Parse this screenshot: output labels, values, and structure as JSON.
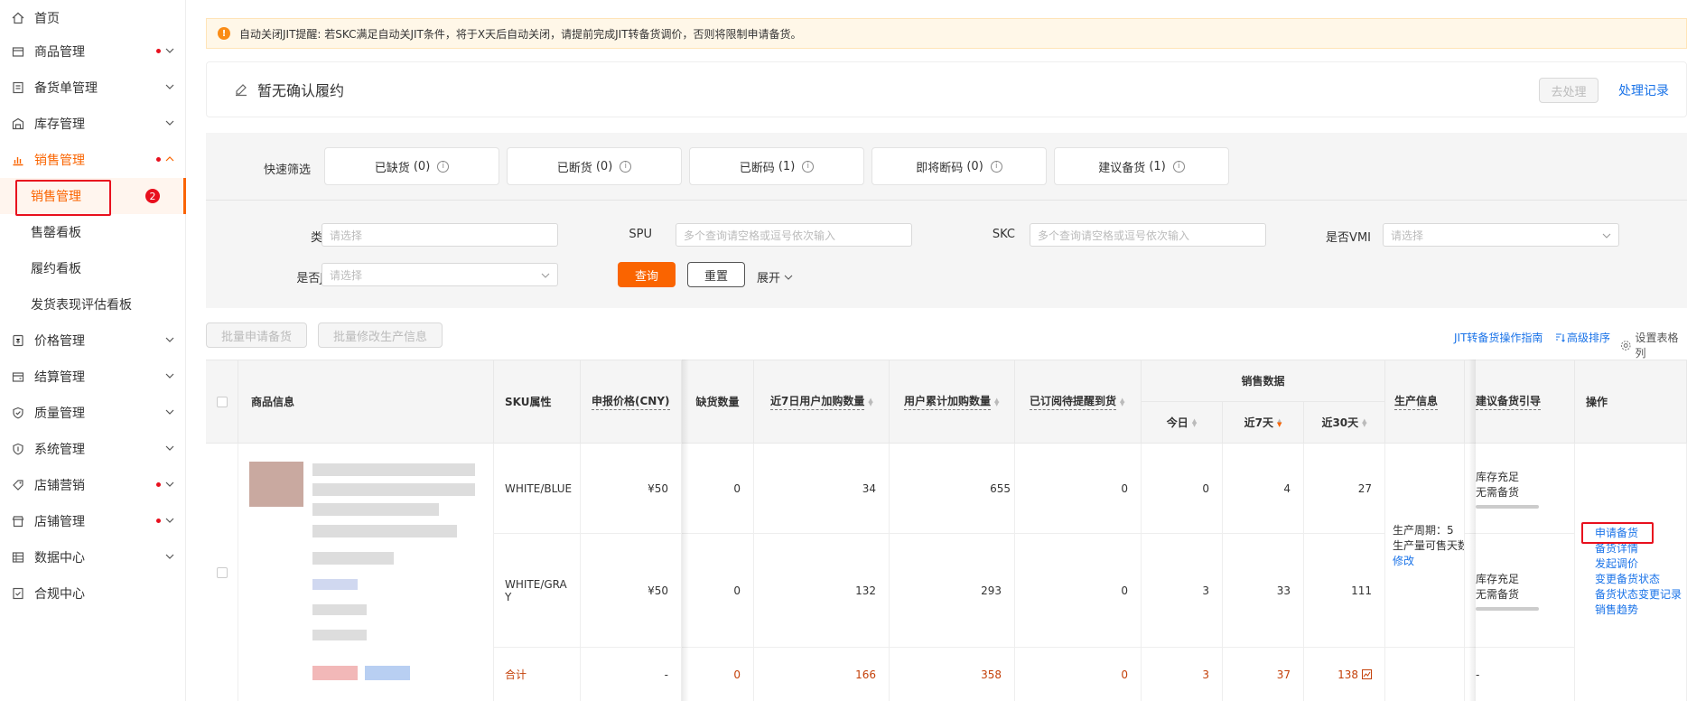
{
  "sidebar": {
    "items": [
      {
        "label": "首页",
        "icon": "home-icon",
        "chevron": false,
        "dot": false
      },
      {
        "label": "商品管理",
        "icon": "goods-icon",
        "chevron": true,
        "dot": true
      },
      {
        "label": "备货单管理",
        "icon": "order-icon",
        "chevron": true,
        "dot": false
      },
      {
        "label": "库存管理",
        "icon": "warehouse-icon",
        "chevron": true,
        "dot": false
      },
      {
        "label": "销售管理",
        "icon": "sales-chart-icon",
        "chevron": true,
        "dot": true,
        "active": true
      },
      {
        "label": "价格管理",
        "icon": "price-tag-icon",
        "chevron": true,
        "dot": false
      },
      {
        "label": "结算管理",
        "icon": "wallet-icon",
        "chevron": true,
        "dot": false
      },
      {
        "label": "质量管理",
        "icon": "shield-icon",
        "chevron": true,
        "dot": false
      },
      {
        "label": "系统管理",
        "icon": "system-icon",
        "chevron": true,
        "dot": false
      },
      {
        "label": "店铺营销",
        "icon": "marketing-icon",
        "chevron": true,
        "dot": true
      },
      {
        "label": "店铺管理",
        "icon": "store-icon",
        "chevron": true,
        "dot": true
      },
      {
        "label": "数据中心",
        "icon": "data-icon",
        "chevron": true,
        "dot": false
      },
      {
        "label": "合规中心",
        "icon": "compliance-icon",
        "chevron": false,
        "dot": false
      }
    ],
    "sub_items": [
      {
        "label": "销售管理",
        "selected": true,
        "badge": "2"
      },
      {
        "label": "售罄看板"
      },
      {
        "label": "履约看板"
      },
      {
        "label": "发货表现评估看板"
      }
    ]
  },
  "alert": {
    "text": "自动关闭JIT提醒: 若SKC满足自动关JIT条件，将于X天后自动关闭，请提前完成JIT转备货调价，否则将限制申请备货。"
  },
  "confirm": {
    "title": "暂无确认履约",
    "process_label": "去处理",
    "history_link": "处理记录"
  },
  "quick_filter": {
    "label": "快速筛选",
    "cards": [
      {
        "label": "已缺货",
        "count": "(0)"
      },
      {
        "label": "已断货",
        "count": "(0)"
      },
      {
        "label": "已断码",
        "count": "(1)"
      },
      {
        "label": "即将断码",
        "count": "(0)"
      },
      {
        "label": "建议备货",
        "count": "(1)"
      }
    ]
  },
  "filters": {
    "category_label": "类目",
    "category_placeholder": "请选择",
    "spu_label": "SPU",
    "spu_placeholder": "多个查询请空格或逗号依次输入",
    "skc_label": "SKC",
    "skc_placeholder": "多个查询请空格或逗号依次输入",
    "vmi_label": "是否VMI",
    "vmi_placeholder": "请选择",
    "jit_label": "是否JIT",
    "jit_placeholder": "请选择",
    "query_label": "查询",
    "reset_label": "重置",
    "expand_label": "展开"
  },
  "toolbar": {
    "batch_apply": "批量申请备货",
    "batch_edit": "批量修改生产信息",
    "guide_link": "JIT转备货操作指南",
    "sort_link": "高级排序",
    "settings_link": "设置表格列"
  },
  "table": {
    "headers": {
      "product": "商品信息",
      "sku": "SKU属性",
      "price": "申报价格(CNY)",
      "shortage": "缺货数量",
      "cart7": "近7日用户加购数量",
      "cart_total": "用户累计加购数量",
      "subscribed": "已订阅待提醒到货",
      "sales_group": "销售数据",
      "today": "今日",
      "d7": "近7天",
      "d30": "近30天",
      "production": "生产信息",
      "suggestion": "建议备货引导",
      "ops": "操作"
    },
    "rows": [
      {
        "sku": "WHITE/BLUE",
        "price": "¥50",
        "shortage": "0",
        "cart7": "34",
        "cart_total": "655",
        "subscribed": "0",
        "today": "0",
        "d7": "4",
        "d30": "27",
        "suggest1": "库存充足",
        "suggest2": "无需备货"
      },
      {
        "sku": "WHITE/GRAY",
        "price": "¥50",
        "shortage": "0",
        "cart7": "132",
        "cart_total": "293",
        "subscribed": "0",
        "today": "3",
        "d7": "33",
        "d30": "111",
        "suggest1": "库存充足",
        "suggest2": "无需备货"
      }
    ],
    "total": {
      "label": "合计",
      "price": "-",
      "shortage": "0",
      "cart7": "166",
      "cart_total": "358",
      "subscribed": "0",
      "today": "3",
      "d7": "37",
      "d30": "138",
      "suggest": "-"
    },
    "production": {
      "line1": "生产周期：5",
      "line2": "生产量可售天数",
      "edit": "修改"
    },
    "ops": [
      "申请备货",
      "备货详情",
      "发起调价",
      "变更备货状态",
      "备货状态变更记录",
      "销售趋势"
    ]
  },
  "colors": {
    "accent": "#fa6400",
    "link": "#1a73e8",
    "alert_bg": "#fff7e8",
    "highlight": "#e8101e"
  }
}
